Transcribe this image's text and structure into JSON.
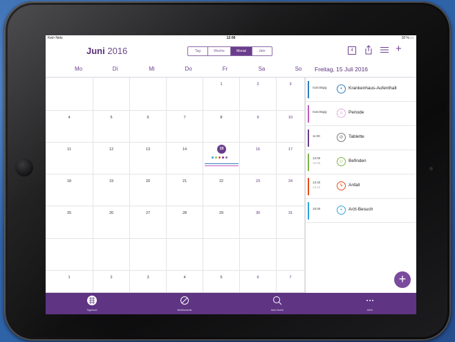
{
  "status_bar": {
    "carrier": "Kein Netz",
    "time": "12:06",
    "battery": "18 %"
  },
  "header": {
    "month": "Juni",
    "year": "2016",
    "segments": [
      {
        "label": "Tag",
        "active": false
      },
      {
        "label": "Woche",
        "active": false
      },
      {
        "label": "Monat",
        "active": true
      },
      {
        "label": "Jahr",
        "active": false
      }
    ],
    "calendar_icon_label": "4",
    "icons": [
      "calendar-icon",
      "share-icon",
      "list-icon",
      "plus-icon"
    ]
  },
  "weekdays": [
    "Mo",
    "Di",
    "Mi",
    "Do",
    "Fr",
    "Sa",
    "So"
  ],
  "calendar": {
    "weeks": [
      [
        "",
        "",
        "",
        "",
        "1",
        "2",
        "3"
      ],
      [
        "4",
        "5",
        "6",
        "7",
        "8",
        "9",
        "10"
      ],
      [
        "11",
        "12",
        "13",
        "14",
        "15",
        "16",
        "17"
      ],
      [
        "18",
        "19",
        "20",
        "21",
        "22",
        "23",
        "24"
      ],
      [
        "25",
        "26",
        "27",
        "28",
        "29",
        "30",
        "31"
      ],
      [
        "",
        "",
        "",
        "",
        "",
        "",
        ""
      ],
      [
        "1",
        "2",
        "3",
        "4",
        "5",
        "6",
        "7"
      ]
    ],
    "today": "15",
    "today_dot_colors": [
      "#3aa0d8",
      "#8bc34a",
      "#e6493a",
      "#6a3d8c",
      "#8a6aa5"
    ]
  },
  "day_panel": {
    "title": "Freitag, 15 Juli 2016",
    "events": [
      {
        "time": "Ganztägig",
        "time_end": "",
        "label": "Krankenhaus-Aufenthalt",
        "color": "#2c7cc1",
        "icon": "hospital-icon"
      },
      {
        "time": "Ganztägig",
        "time_end": "",
        "label": "Periode",
        "color": "#c05ac0",
        "icon": "period-icon"
      },
      {
        "time": "11:00",
        "time_end": "",
        "label": "Tablette",
        "color": "#6a3d8c",
        "icon": "pill-icon"
      },
      {
        "time": "12:00",
        "time_end": "15:00",
        "label": "Befinden",
        "color": "#7cb342",
        "icon": "mood-icon"
      },
      {
        "time": "13:40",
        "time_end": "13:42",
        "label": "Anfall",
        "color": "#e64a19",
        "icon": "seizure-icon"
      },
      {
        "time": "15:00",
        "time_end": "",
        "label": "Arzt-Besuch",
        "color": "#2aa3d8",
        "icon": "doctor-icon"
      }
    ],
    "add_button": "+"
  },
  "tabbar": {
    "tabs": [
      {
        "label": "Tagebuch",
        "icon": "diary-icon"
      },
      {
        "label": "Medikamente",
        "icon": "medication-icon"
      },
      {
        "label": "Auto-Suche",
        "icon": "search-icon"
      },
      {
        "label": "Mehr",
        "icon": "more-icon"
      }
    ]
  }
}
